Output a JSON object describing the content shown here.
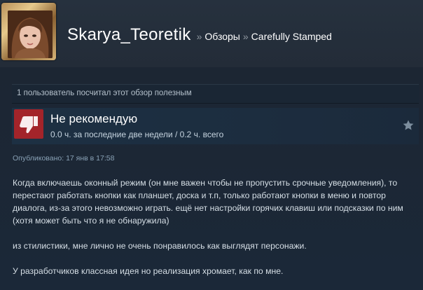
{
  "header": {
    "username": "Skarya_Teoretik",
    "separator": "»",
    "breadcrumb": [
      "Обзоры",
      "Carefully Stamped"
    ]
  },
  "helpful": {
    "text": "1 пользователь посчитал этот обзор полезным"
  },
  "recommendation": {
    "title": "Не рекомендую",
    "hours": "0.0 ч. за последние две недели / 0.2 ч. всего",
    "icon": "thumbs-down-icon",
    "icon_color": "#a3242a"
  },
  "posted": "Опубликовано: 17 янв в 17:58",
  "review": {
    "paragraphs": [
      "Когда включаешь оконный режим (он мне важен чтобы не пропустить срочные уведомления), то перестают работать кнопки как планшет, доска и т.п, только работают кнопки в меню и повтор диалога, из-за этого невозможно играть. ещё нет настройки горячих клавиш или подсказки по ним (хотя может быть что я не обнаружила)",
      "из стилистики, мне лично не очень понравилось как выглядят персонажи.",
      "У разработчиков классная идея но реализация хромает, как по мне."
    ]
  },
  "colors": {
    "background": "#1b2838",
    "accent_red": "#a3242a",
    "text": "#c6d4df"
  }
}
